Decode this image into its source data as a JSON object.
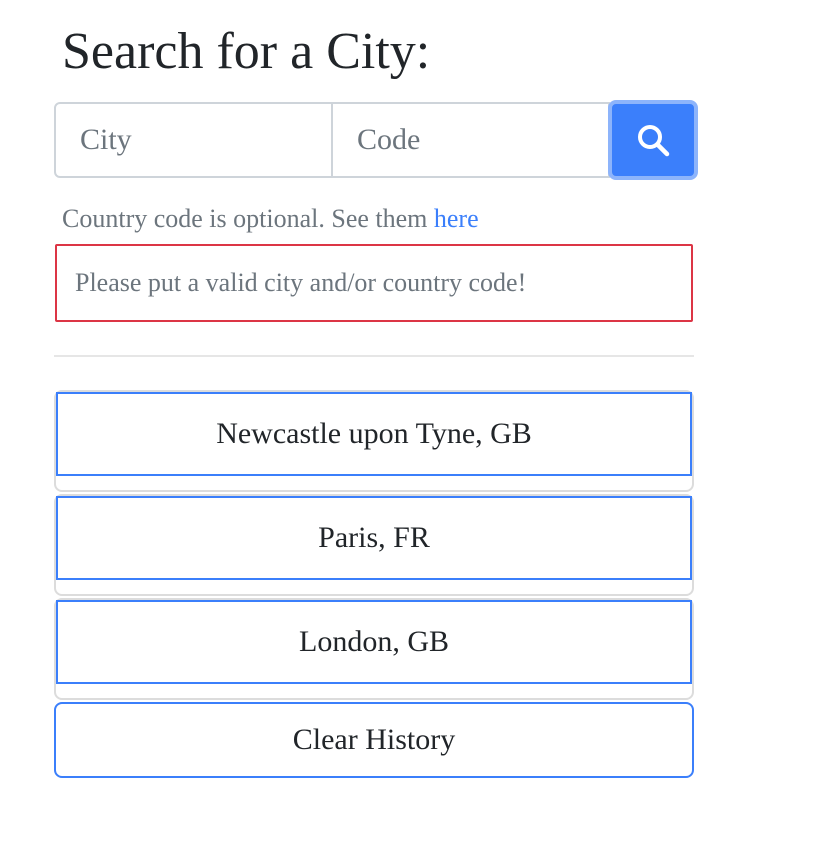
{
  "header": {
    "title": "Search for a City:"
  },
  "search": {
    "city_placeholder": "City",
    "city_value": "",
    "code_placeholder": "Code",
    "code_value": "",
    "button_icon": "search-icon"
  },
  "help": {
    "text": "Country code is optional. See them ",
    "link_label": "here"
  },
  "error": {
    "message": "Please put a valid city and/or country code!"
  },
  "history": {
    "items": [
      {
        "label": "Newcastle upon Tyne, GB"
      },
      {
        "label": "Paris, FR"
      },
      {
        "label": "London, GB"
      }
    ],
    "clear_label": "Clear History"
  },
  "colors": {
    "primary": "#3b7ffb",
    "danger": "#dc3545",
    "muted": "#6c757d",
    "text": "#212529"
  }
}
